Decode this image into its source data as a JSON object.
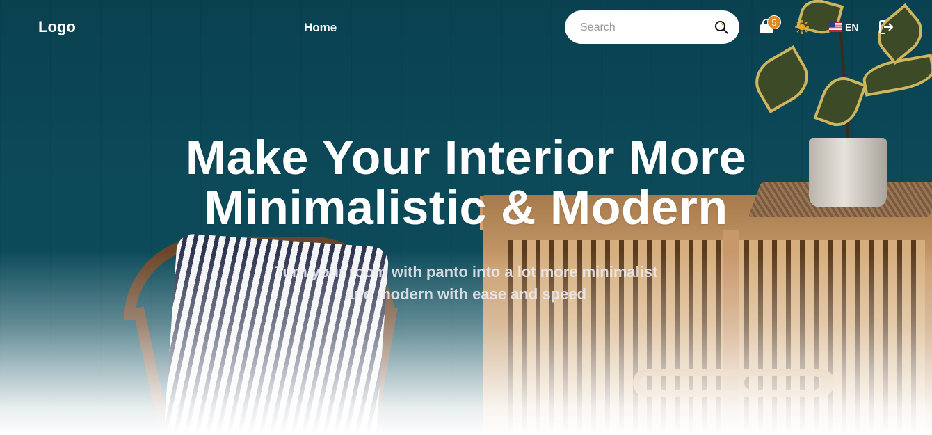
{
  "navbar": {
    "logo": "Logo",
    "links": [
      {
        "label": "Home"
      }
    ],
    "search": {
      "placeholder": "Search",
      "icon": "search-icon"
    },
    "cart": {
      "icon": "shopping-bag-icon",
      "count": "5"
    },
    "theme_toggle": {
      "icon": "sun-icon"
    },
    "language": {
      "flag": "us-flag-icon",
      "label": "EN"
    },
    "logout": {
      "icon": "logout-icon"
    }
  },
  "hero": {
    "headline": [
      "Make Your Interior More",
      "Minimalistic & Modern"
    ],
    "subtext": [
      "Turn your room with panto into a lot more minimalist",
      "and modern with ease and speed"
    ]
  },
  "colors": {
    "background_teal": "#0b4453",
    "badge_orange": "#e08a1e",
    "text_white": "#ffffff"
  }
}
